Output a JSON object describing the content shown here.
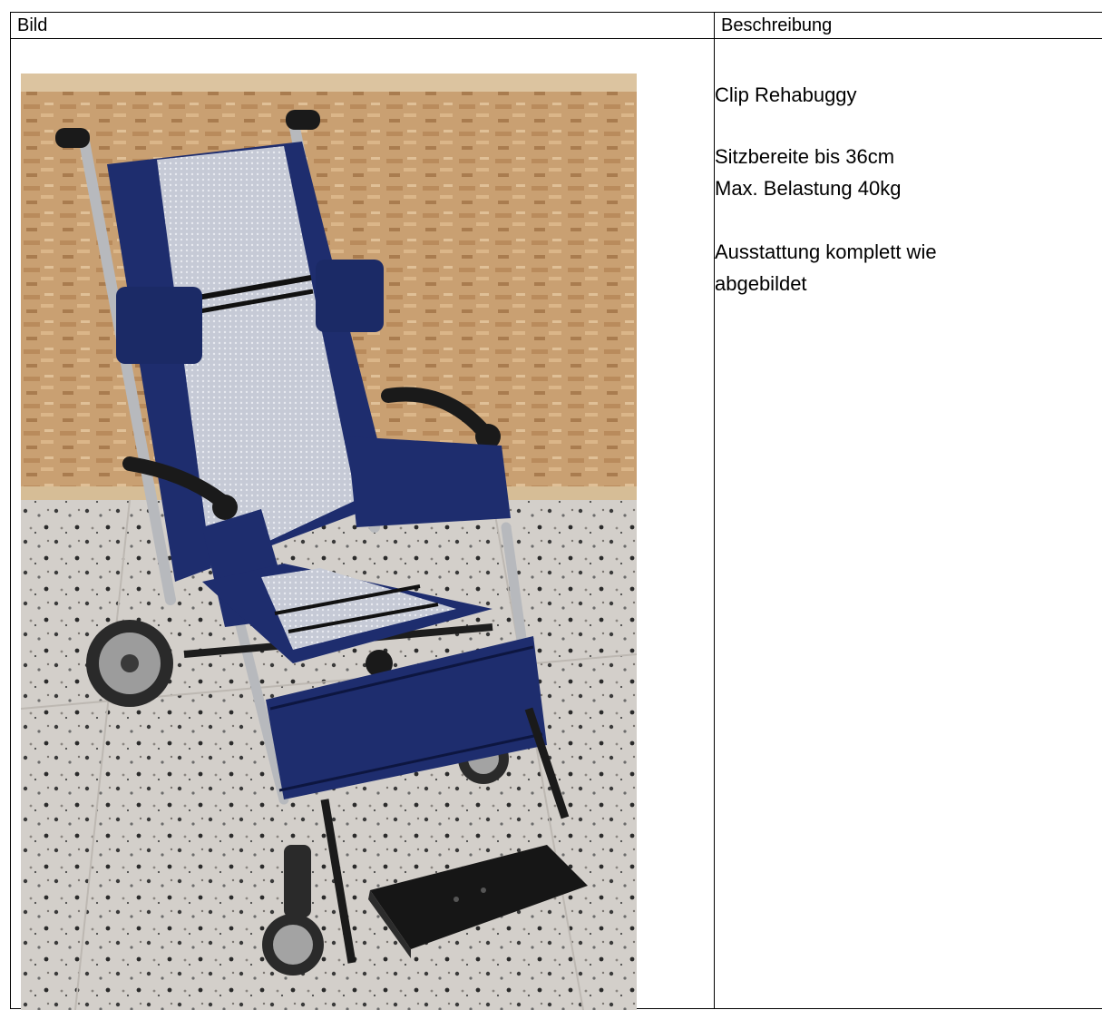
{
  "table": {
    "header": {
      "image_column": "Bild",
      "description_column": "Beschreibung"
    },
    "product": {
      "name": "Clip Rehabuggy",
      "specs": [
        "Sitzbereite bis 36cm",
        "Max. Belastung 40kg"
      ],
      "equipment": "Ausstattung komplett wie abgebildet"
    }
  },
  "colors": {
    "border": "#000000",
    "upholstery_blue": "#1e2d6e",
    "mesh_gray": "#c9ccd6",
    "osb_wall": "#c9a072",
    "terrazzo_floor": "#cfcbc6",
    "frame_aluminium": "#b7b9bd"
  }
}
